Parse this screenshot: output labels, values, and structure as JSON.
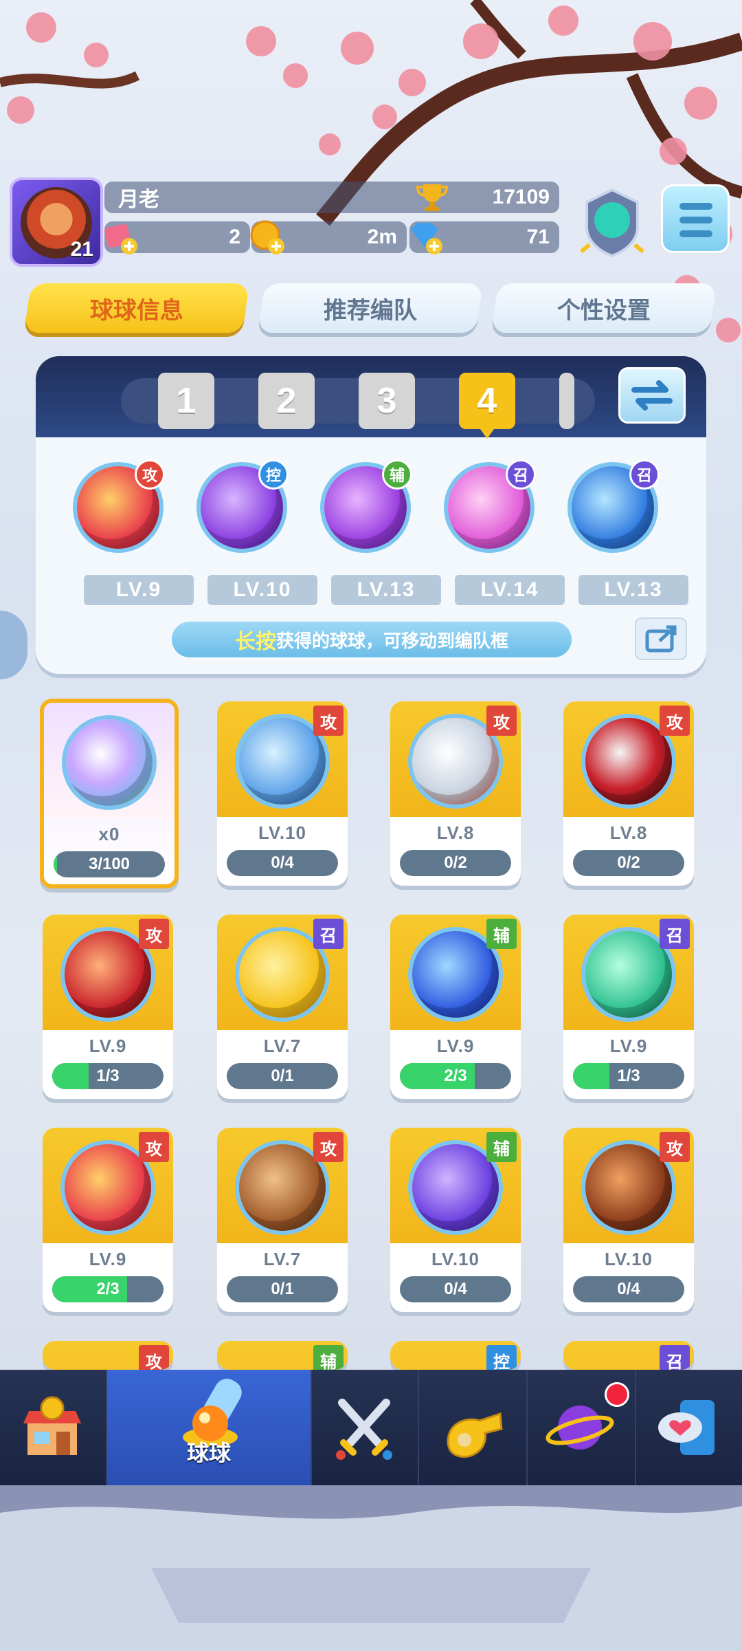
{
  "player": {
    "name": "月老",
    "level": "21",
    "trophies": "17109",
    "resources": [
      {
        "icon": "ticket-icon",
        "value": "2"
      },
      {
        "icon": "gold-coin-icon",
        "value": "2m"
      },
      {
        "icon": "diamond-icon",
        "value": "71"
      }
    ]
  },
  "tabs": [
    "球球信息",
    "推荐编队",
    "个性设置"
  ],
  "team": {
    "slots": [
      "1",
      "2",
      "3",
      "4"
    ],
    "active_slot": "4",
    "balls": [
      {
        "tag": "攻",
        "level": "LV.9"
      },
      {
        "tag": "控",
        "level": "LV.10"
      },
      {
        "tag": "辅",
        "level": "LV.13"
      },
      {
        "tag": "召",
        "level": "LV.14"
      },
      {
        "tag": "召",
        "level": "LV.13"
      }
    ],
    "hint_em": "长按",
    "hint_rest": "获得的球球，可移动到编队框"
  },
  "grid": [
    {
      "tag": "",
      "level": "x0",
      "progress": "3/100",
      "fill": 0.03
    },
    {
      "tag": "攻",
      "level": "LV.10",
      "progress": "0/4",
      "fill": 0
    },
    {
      "tag": "攻",
      "level": "LV.8",
      "progress": "0/2",
      "fill": 0
    },
    {
      "tag": "攻",
      "level": "LV.8",
      "progress": "0/2",
      "fill": 0
    },
    {
      "tag": "攻",
      "level": "LV.9",
      "progress": "1/3",
      "fill": 0.33
    },
    {
      "tag": "召",
      "level": "LV.7",
      "progress": "0/1",
      "fill": 0
    },
    {
      "tag": "辅",
      "level": "LV.9",
      "progress": "2/3",
      "fill": 0.67
    },
    {
      "tag": "召",
      "level": "LV.9",
      "progress": "1/3",
      "fill": 0.33
    },
    {
      "tag": "攻",
      "level": "LV.9",
      "progress": "2/3",
      "fill": 0.67
    },
    {
      "tag": "攻",
      "level": "LV.7",
      "progress": "0/1",
      "fill": 0
    },
    {
      "tag": "辅",
      "level": "LV.10",
      "progress": "0/4",
      "fill": 0
    },
    {
      "tag": "攻",
      "level": "LV.10",
      "progress": "0/4",
      "fill": 0
    }
  ],
  "partial_row_tags": [
    "攻",
    "辅",
    "控",
    "召"
  ],
  "nav": {
    "items": [
      "shop-icon",
      "balls-icon",
      "battle-swords-icon",
      "whistle-icon",
      "planet-icon",
      "social-icon"
    ],
    "active_label": "球球"
  },
  "colors": {
    "accent": "#f6c21a",
    "attack": "#e0473a",
    "control": "#2f8fe0",
    "support": "#4cae3c",
    "summon": "#6b4fd6"
  }
}
